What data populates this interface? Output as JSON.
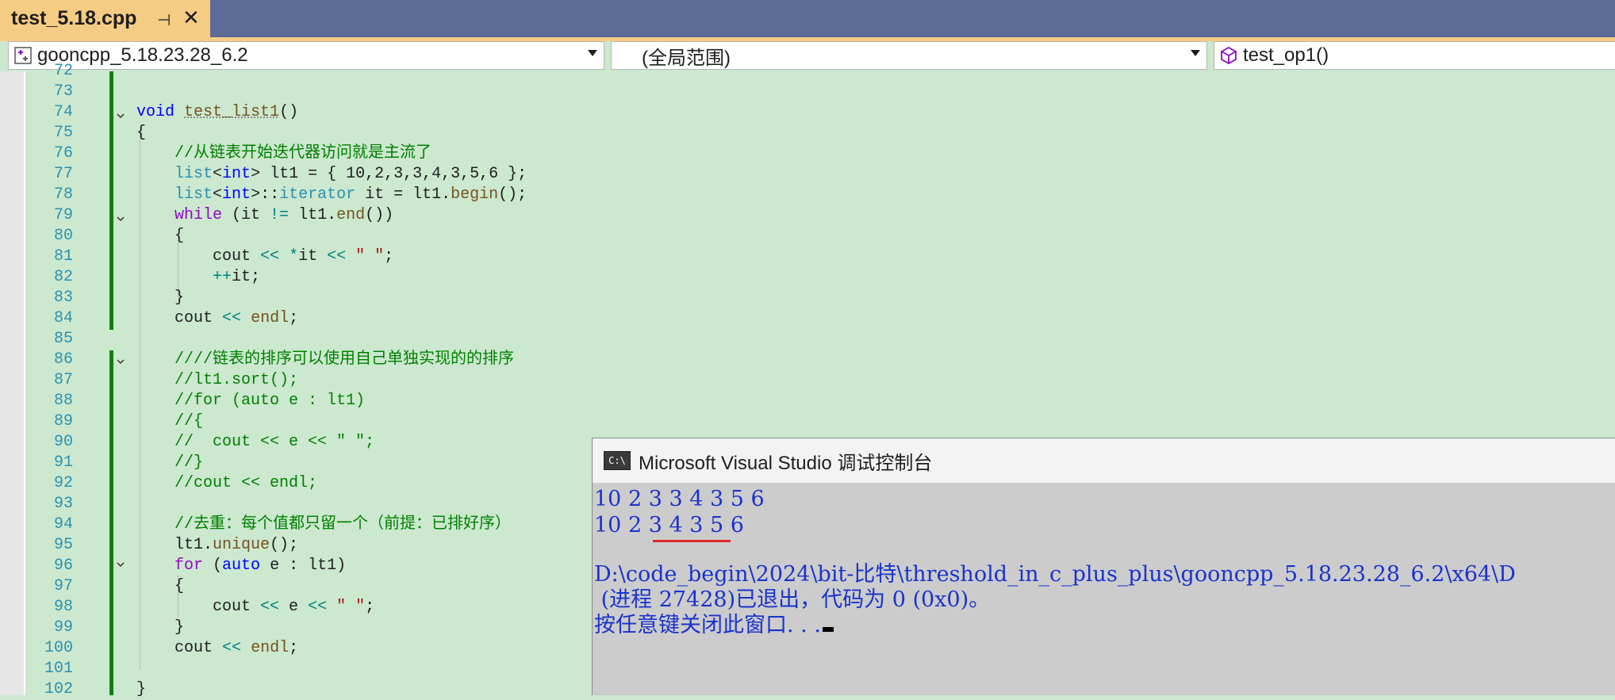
{
  "tab": {
    "title": "test_5.18.cpp",
    "pin": "⊣",
    "close": "✕"
  },
  "navbar": {
    "project": "gooncpp_5.18.23.28_6.2",
    "scope": "(全局范围)",
    "member": "test_op1()"
  },
  "editor": {
    "line_numbers": [
      "72",
      "73",
      "74",
      "75",
      "76",
      "77",
      "78",
      "79",
      "80",
      "81",
      "82",
      "83",
      "84",
      "85",
      "86",
      "87",
      "88",
      "89",
      "90",
      "91",
      "92",
      "93",
      "94",
      "95",
      "96",
      "97",
      "98",
      "99",
      "100",
      "101",
      "102"
    ]
  },
  "console": {
    "title": "Microsoft Visual Studio 调试控制台",
    "icon": "C:\\",
    "lines": [
      "10 2 3 3 4 3 5 6",
      "10 2 3 4 3 5 6",
      "",
      "D:\\code_begin\\2024\\bit-比特\\threshold_in_c_plus_plus\\gooncpp_5.18.23.28_6.2\\x64\\D",
      " (进程 27428)已退出，代码为 0 (0x0)。",
      "按任意键关闭此窗口. . ."
    ]
  },
  "colors": {
    "editor_bg": "#cce8cf",
    "tab_active": "#f5cc84",
    "tab_strip": "#5d6b99",
    "keyword": "#0000ff",
    "comment": "#008000",
    "console_text": "#1a33cc"
  }
}
